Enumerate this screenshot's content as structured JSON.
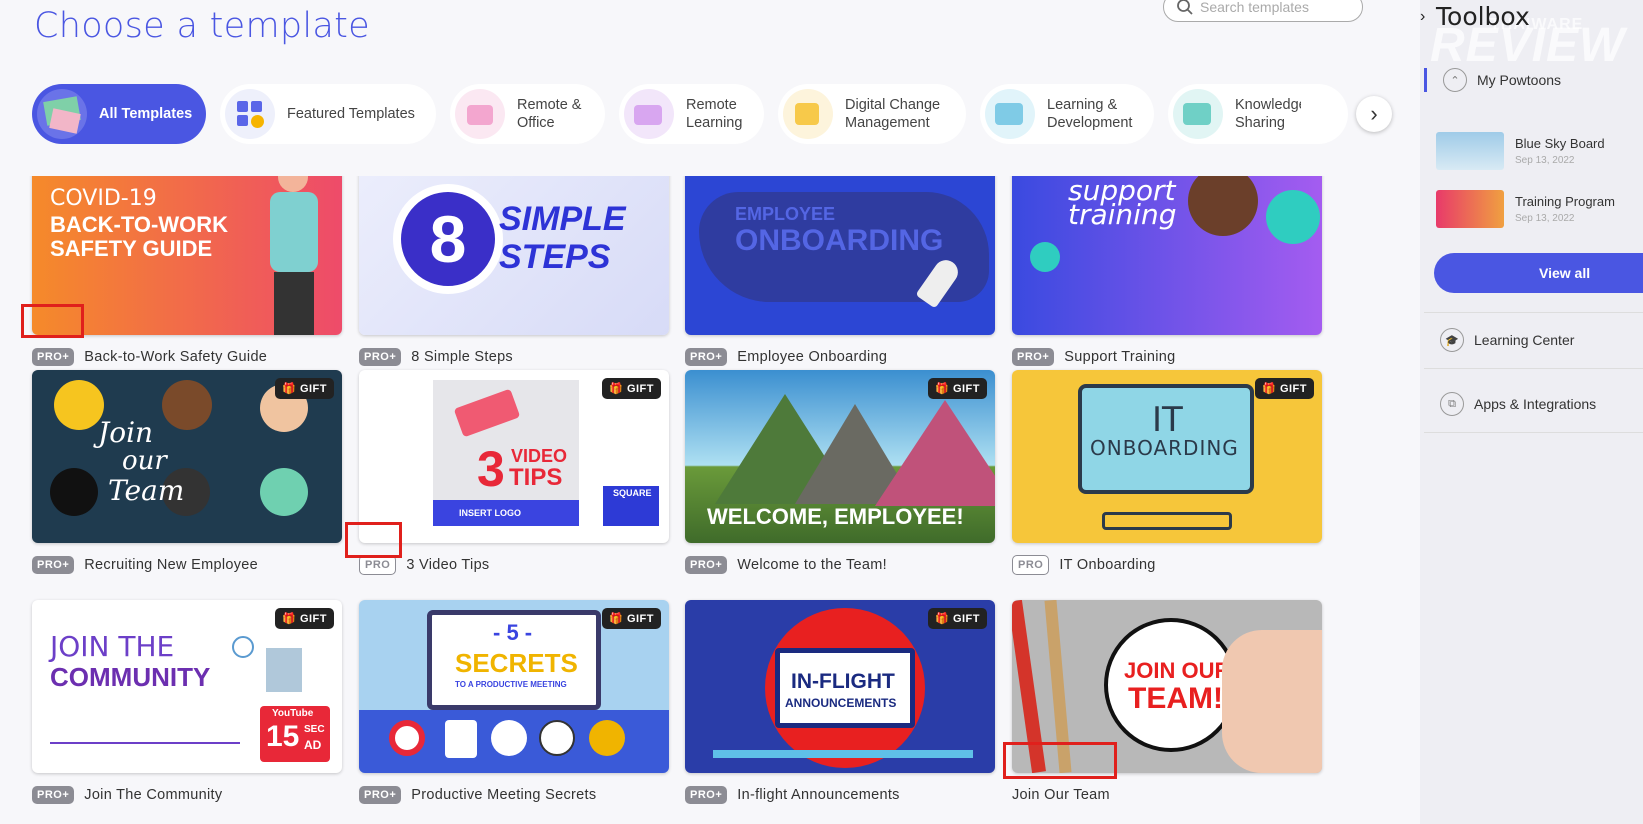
{
  "page": {
    "title": "Choose a template"
  },
  "search": {
    "placeholder": "Search templates"
  },
  "tabs": [
    {
      "label": "All Templates"
    },
    {
      "label": "Featured Templates"
    },
    {
      "label": "Remote & Office"
    },
    {
      "label": "Remote Learning"
    },
    {
      "label": "Digital Change Management"
    },
    {
      "label": "Learning & Development"
    },
    {
      "label": "Knowledge Sharing"
    }
  ],
  "cards": [
    {
      "name": "Back-to-Work Safety Guide",
      "badge": "PRO+",
      "gift": "",
      "art": {
        "line1": "COVID-19",
        "line2": "BACK-TO-WORK",
        "line3": "SAFETY GUIDE"
      }
    },
    {
      "name": "8 Simple Steps",
      "badge": "PRO+",
      "gift": "",
      "art": {
        "num": "8",
        "line1": "SIMPLE",
        "line2": "STEPS"
      }
    },
    {
      "name": "Employee Onboarding",
      "badge": "PRO+",
      "gift": "",
      "art": {
        "line1": "EMPLOYEE",
        "line2": "ONBOARDING"
      }
    },
    {
      "name": "Support Training",
      "badge": "PRO+",
      "gift": "",
      "art": {
        "line1": "support",
        "line2": "training"
      }
    },
    {
      "name": "Recruiting New Employee",
      "badge": "PRO+",
      "gift": "GIFT",
      "art": {
        "line1": "Join",
        "line2": "our",
        "line3": "Team"
      }
    },
    {
      "name": "3 Video Tips",
      "badge": "PRO",
      "gift": "GIFT",
      "art": {
        "line1": "3",
        "line2": "VIDEO",
        "line3": "TIPS",
        "logo": "INSERT LOGO",
        "square": "SQUARE"
      }
    },
    {
      "name": "Welcome to the Team!",
      "badge": "PRO+",
      "gift": "GIFT",
      "art": {
        "line1": "WELCOME, EMPLOYEE!"
      }
    },
    {
      "name": "IT Onboarding",
      "badge": "PRO",
      "gift": "GIFT",
      "art": {
        "line1": "IT",
        "line2": "ONBOARDING"
      }
    },
    {
      "name": "Join The Community",
      "badge": "PRO+",
      "gift": "GIFT",
      "art": {
        "line1": "JOIN THE",
        "line2": "COMMUNITY",
        "yt": "YouTube",
        "sec": "15",
        "secunit": "SEC",
        "ad": "AD"
      }
    },
    {
      "name": "Productive Meeting Secrets",
      "badge": "PRO+",
      "gift": "GIFT",
      "art": {
        "line1": "- 5 -",
        "line2": "SECRETS",
        "line3": "TO A PRODUCTIVE MEETING"
      }
    },
    {
      "name": "In-flight Announcements",
      "badge": "PRO+",
      "gift": "GIFT",
      "art": {
        "line1": "IN-FLIGHT",
        "line2": "ANNOUNCEMENTS"
      }
    },
    {
      "name": "Join Our Team",
      "badge": "",
      "gift": "",
      "art": {
        "line1": "JOIN OUR",
        "line2": "TEAM!"
      }
    }
  ],
  "sidebar": {
    "title": "Toolbox",
    "watermark": "REVIEW",
    "watermark_small": "THAIWARE",
    "my_powtoons": "My Powtoons",
    "powtoons": [
      {
        "name": "Blue Sky Board",
        "date": "Sep 13, 2022"
      },
      {
        "name": "Training Program",
        "date": "Sep 13, 2022"
      }
    ],
    "view_all": "View all",
    "learning_center": "Learning Center",
    "apps": "Apps & Integrations"
  },
  "colors": {
    "accent": "#4a56e2",
    "highlight": "#e0201c"
  }
}
